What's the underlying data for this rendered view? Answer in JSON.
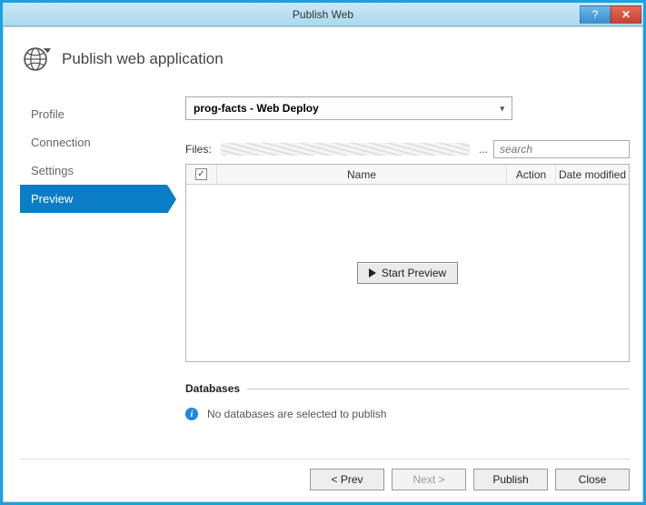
{
  "window": {
    "title": "Publish Web"
  },
  "header": {
    "title": "Publish web application"
  },
  "sidebar": {
    "items": [
      {
        "label": "Profile"
      },
      {
        "label": "Connection"
      },
      {
        "label": "Settings"
      },
      {
        "label": "Preview"
      }
    ],
    "active_index": 3
  },
  "main": {
    "profile_select": {
      "value": "prog-facts - Web Deploy"
    },
    "files_label": "Files:",
    "files_path_redacted": true,
    "search": {
      "placeholder": "search",
      "value": ""
    },
    "table": {
      "columns": [
        "",
        "Name",
        "Action",
        "Date modified"
      ],
      "select_all_checked": true,
      "rows": []
    },
    "start_preview_label": "Start Preview",
    "databases": {
      "heading": "Databases",
      "message": "No databases are selected to publish"
    }
  },
  "footer": {
    "prev": "< Prev",
    "next": "Next >",
    "publish": "Publish",
    "close": "Close",
    "next_enabled": false
  }
}
